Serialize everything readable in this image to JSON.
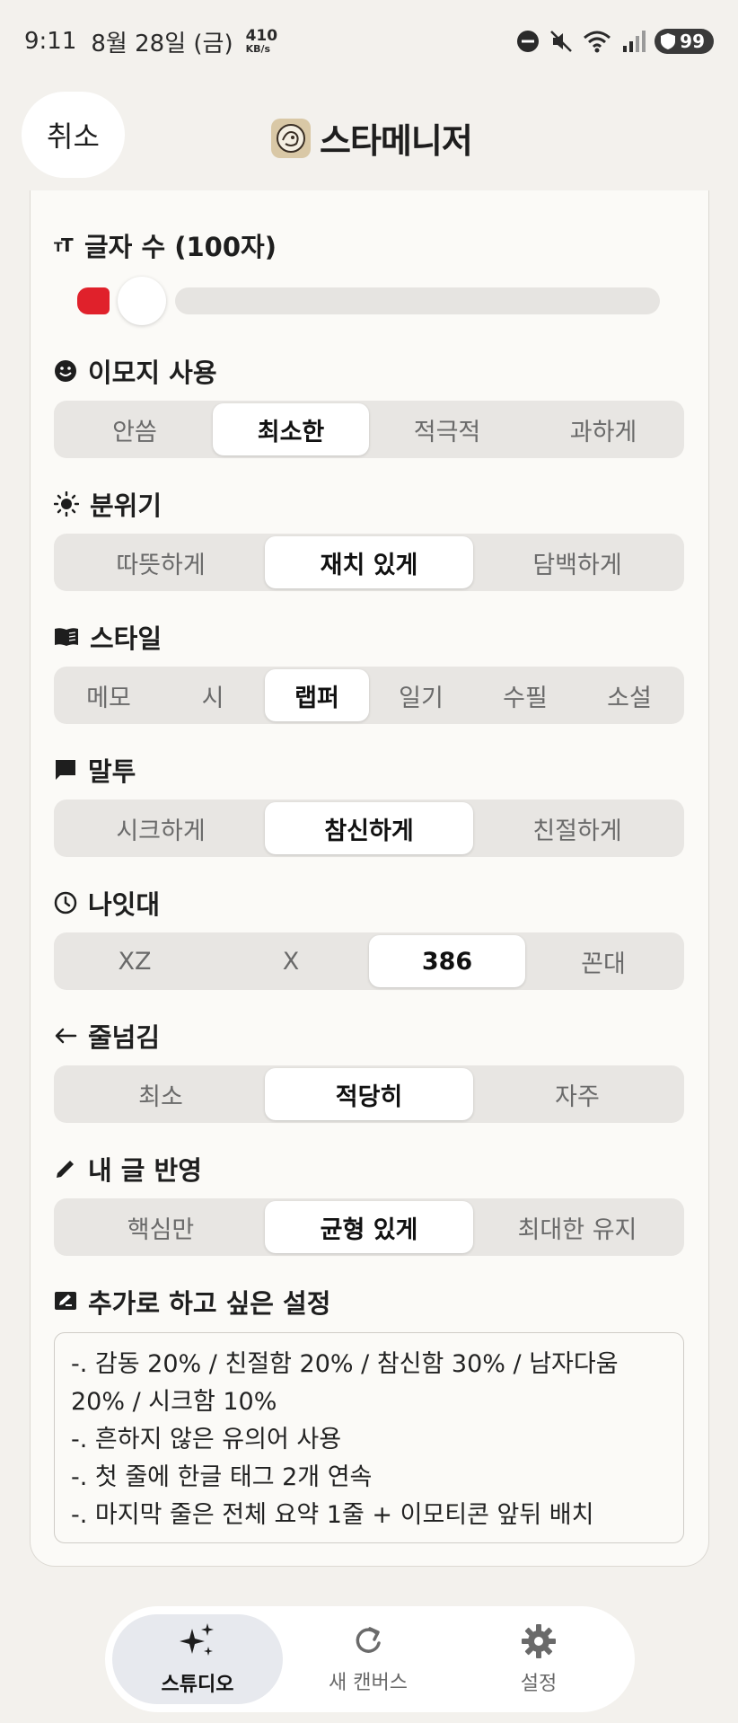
{
  "status_bar": {
    "time": "9:11",
    "date": "8월 28일 (금)",
    "net_speed": "410",
    "net_unit": "KB/s",
    "battery": "99"
  },
  "header": {
    "cancel_label": "취소",
    "title": "스타메니저"
  },
  "char_count": {
    "label": "글자 수 (100자)",
    "value_fraction": 0.0
  },
  "emoji": {
    "label": "이모지 사용",
    "options": [
      "안씀",
      "최소한",
      "적극적",
      "과하게"
    ],
    "selected": "최소한"
  },
  "mood": {
    "label": "분위기",
    "options": [
      "따뜻하게",
      "재치 있게",
      "담백하게"
    ],
    "selected": "재치 있게"
  },
  "style": {
    "label": "스타일",
    "options": [
      "메모",
      "시",
      "랩퍼",
      "일기",
      "수필",
      "소설"
    ],
    "selected": "랩퍼"
  },
  "tone": {
    "label": "말투",
    "options": [
      "시크하게",
      "참신하게",
      "친절하게"
    ],
    "selected": "참신하게"
  },
  "age": {
    "label": "나잇대",
    "options": [
      "XZ",
      "X",
      "386",
      "꼰대"
    ],
    "selected": "386"
  },
  "linebreak": {
    "label": "줄넘김",
    "options": [
      "최소",
      "적당히",
      "자주"
    ],
    "selected": "적당히"
  },
  "reflect": {
    "label": "내 글 반영",
    "options": [
      "핵심만",
      "균형 있게",
      "최대한 유지"
    ],
    "selected": "균형 있게"
  },
  "extra": {
    "label": "추가로 하고 싶은 설정",
    "lines": [
      "-. 감동 20% / 친절함 20% / 참신함 30% / 남자다움",
      "20% / 시크함 10%",
      "-. 흔하지 않은 유의어 사용",
      "-. 첫 줄에 한글 태그 2개 연속",
      "-. 마지막 줄은 전체 요약 1줄 + 이모티콘 앞뒤 배치"
    ]
  },
  "nav": {
    "items": [
      "스튜디오",
      "새 캔버스",
      "설정"
    ],
    "active": "스튜디오"
  },
  "colors": {
    "accent": "#e0212b",
    "background": "#f3f1ed",
    "card": "#fbfaf7",
    "segment": "#e8e6e3"
  }
}
